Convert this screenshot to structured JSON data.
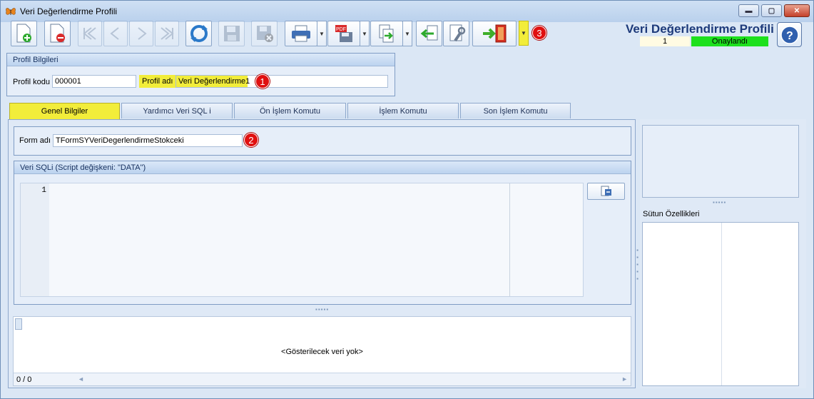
{
  "window": {
    "title": "Veri Değerlendirme Profili",
    "minimize": "▬",
    "maximize": "▢",
    "close": "✕"
  },
  "toolbar": {
    "buttons": [
      {
        "name": "new-record-button",
        "icon": "new-document-icon"
      },
      {
        "name": "delete-record-button",
        "icon": "delete-document-icon"
      },
      {
        "name": "first-record-button",
        "icon": "first-icon",
        "disabled": true
      },
      {
        "name": "prev-record-button",
        "icon": "prev-icon",
        "disabled": true
      },
      {
        "name": "next-record-button",
        "icon": "next-icon",
        "disabled": true
      },
      {
        "name": "last-record-button",
        "icon": "last-icon",
        "disabled": true
      },
      {
        "name": "refresh-button",
        "icon": "refresh-icon"
      },
      {
        "name": "save-button",
        "icon": "save-icon",
        "disabled": true
      },
      {
        "name": "cancel-save-button",
        "icon": "save-cancel-icon",
        "disabled": true
      },
      {
        "name": "print-button",
        "icon": "printer-icon"
      },
      {
        "name": "pdf-button",
        "icon": "pdf-icon"
      },
      {
        "name": "export-button",
        "icon": "export-icon"
      },
      {
        "name": "import-button",
        "icon": "import-icon"
      },
      {
        "name": "settings-button",
        "icon": "wrench-icon"
      },
      {
        "name": "exit-button",
        "icon": "exit-door-icon"
      }
    ],
    "badge_3": "3"
  },
  "profile_header": {
    "title": "Veri Değerlendirme Profili",
    "number": "1",
    "status": "Onaylandı",
    "status_color": "#1de01d"
  },
  "profile_info": {
    "heading": "Profil Bilgileri",
    "code_label": "Profil kodu",
    "code_value": "000001",
    "name_label": "Profil adı",
    "name_value": "Veri Değerlendirme1",
    "badge_1": "1"
  },
  "tabs": [
    {
      "label": "Genel Bilgiler",
      "active": true
    },
    {
      "label": "Yardımcı Veri SQL i",
      "active": false
    },
    {
      "label": "Ön İşlem Komutu",
      "active": false
    },
    {
      "label": "İşlem Komutu",
      "active": false
    },
    {
      "label": "Son İşlem Komutu",
      "active": false
    }
  ],
  "general": {
    "form_label": "Form adı",
    "form_value": "TFormSYVeriDegerlendirmeStokceki",
    "badge_2": "2",
    "sql_heading": "Veri SQLi (Script değişkeni: \"DATA\")",
    "line_number": "1"
  },
  "grid": {
    "empty_message": "<Gösterilecek veri yok>",
    "record_count": "0 / 0"
  },
  "right_panel": {
    "column_props_label": "Sütun Özellikleri"
  },
  "colors": {
    "highlight_yellow": "#f2ed3a",
    "badge_red": "#e01010"
  }
}
